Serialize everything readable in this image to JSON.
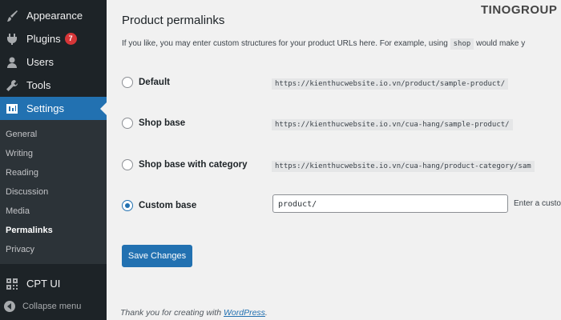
{
  "sidebar": {
    "menu": [
      {
        "label": "Appearance",
        "icon": "paintbrush-icon"
      },
      {
        "label": "Plugins",
        "icon": "plugin-icon",
        "badge": "7"
      },
      {
        "label": "Users",
        "icon": "users-icon"
      },
      {
        "label": "Tools",
        "icon": "wrench-icon"
      },
      {
        "label": "Settings",
        "icon": "settings-icon"
      }
    ],
    "submenu": [
      "General",
      "Writing",
      "Reading",
      "Discussion",
      "Media",
      "Permalinks",
      "Privacy"
    ],
    "cpt": "CPT UI",
    "collapse": "Collapse menu"
  },
  "brand": "TINOGROUP",
  "section": {
    "title": "Product permalinks",
    "desc_before": "If you like, you may enter custom structures for your product URLs here. For example, using",
    "desc_code": "shop",
    "desc_after": "would make y"
  },
  "options": [
    {
      "label": "Default",
      "url": "https://kienthucwebsite.io.vn/product/sample-product/",
      "checked": false
    },
    {
      "label": "Shop base",
      "url": "https://kienthucwebsite.io.vn/cua-hang/sample-product/",
      "checked": false
    },
    {
      "label": "Shop base with category",
      "url": "https://kienthucwebsite.io.vn/cua-hang/product-category/sam",
      "checked": false
    },
    {
      "label": "Custom base",
      "value": "product/",
      "checked": true
    }
  ],
  "custom_hint": "Enter a custo",
  "save_label": "Save Changes",
  "footer": {
    "text": "Thank you for creating with",
    "link": "WordPress",
    "end": "."
  },
  "colors": {
    "accent": "#2271b1",
    "sidebar_bg": "#1d2327",
    "badge": "#d63638"
  }
}
